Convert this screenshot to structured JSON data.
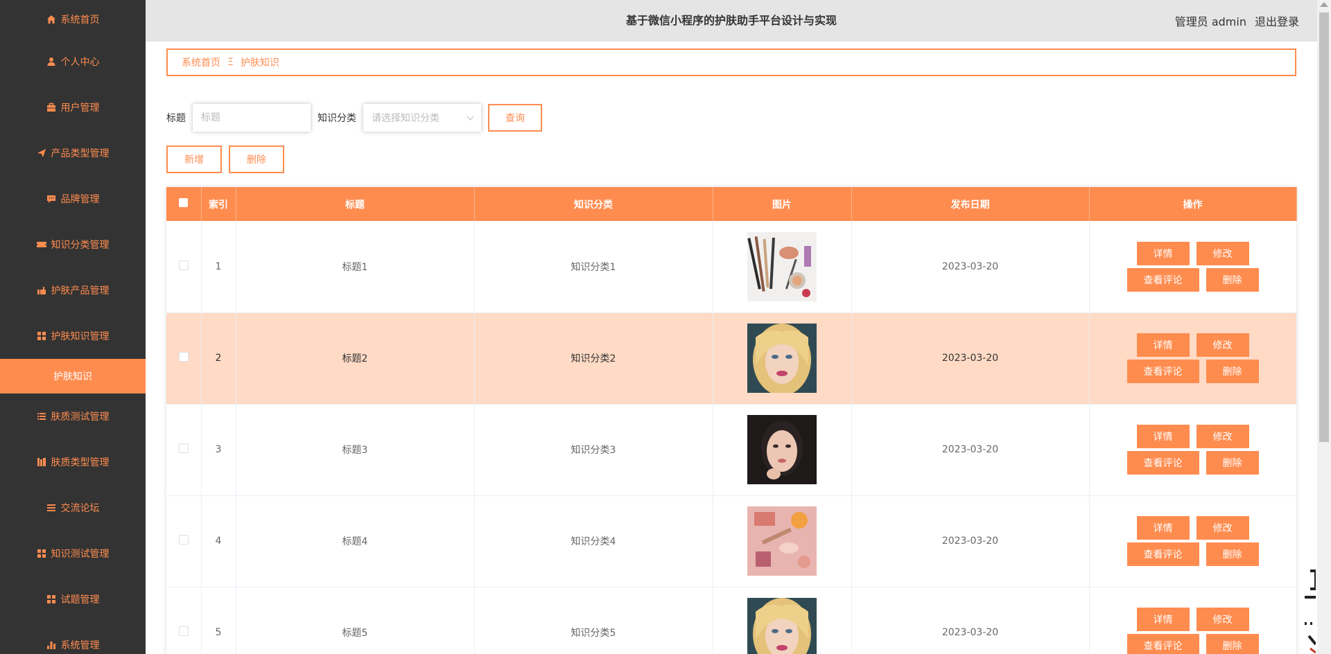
{
  "header": {
    "title": "基于微信小程序的护肤助手平台设计与实现",
    "user": "管理员 admin",
    "logout": "退出登录"
  },
  "sidebar": {
    "items": [
      {
        "label": "系统首页",
        "icon": "home-icon"
      },
      {
        "label": "个人中心",
        "icon": "user-icon"
      },
      {
        "label": "用户管理",
        "icon": "briefcase-icon"
      },
      {
        "label": "产品类型管理",
        "icon": "paper-plane-icon"
      },
      {
        "label": "品牌管理",
        "icon": "chat-icon"
      },
      {
        "label": "知识分类管理",
        "icon": "ticket-icon"
      },
      {
        "label": "护肤产品管理",
        "icon": "hand-icon"
      },
      {
        "label": "护肤知识管理",
        "icon": "grid-icon"
      },
      {
        "label": "肤质测试管理",
        "icon": "list-icon"
      },
      {
        "label": "肤质类型管理",
        "icon": "book-icon"
      },
      {
        "label": "交流论坛",
        "icon": "menu-icon"
      },
      {
        "label": "知识测试管理",
        "icon": "grid-icon"
      },
      {
        "label": "试题管理",
        "icon": "grid-icon"
      },
      {
        "label": "系统管理",
        "icon": "bar-chart-icon"
      }
    ],
    "active_sub": "护肤知识"
  },
  "breadcrumb": {
    "home": "系统首页",
    "separator": "Ξ",
    "current": "护肤知识"
  },
  "search": {
    "title_label": "标题",
    "title_placeholder": "标题",
    "category_label": "知识分类",
    "category_placeholder": "请选择知识分类",
    "query_button": "查询"
  },
  "actions": {
    "add": "新增",
    "delete": "删除"
  },
  "table": {
    "columns": [
      "索引",
      "标题",
      "知识分类",
      "图片",
      "发布日期",
      "操作"
    ],
    "buttons": {
      "detail": "详情",
      "edit": "修改",
      "comments": "查看评论",
      "delete": "删除"
    },
    "rows": [
      {
        "index": "1",
        "title": "标题1",
        "category": "知识分类1",
        "date": "2023-03-20",
        "image": "makeup-brushes"
      },
      {
        "index": "2",
        "title": "标题2",
        "category": "知识分类2",
        "date": "2023-03-20",
        "image": "blonde-portrait"
      },
      {
        "index": "3",
        "title": "标题3",
        "category": "知识分类3",
        "date": "2023-03-20",
        "image": "dark-hair-portrait"
      },
      {
        "index": "4",
        "title": "标题4",
        "category": "知识分类4",
        "date": "2023-03-20",
        "image": "pink-cosmetics-flatlay"
      },
      {
        "index": "5",
        "title": "标题5",
        "category": "知识分类5",
        "date": "2023-03-20",
        "image": "blonde-portrait"
      }
    ]
  },
  "colors": {
    "accent": "#ff8c4f",
    "sidebar_bg": "#333333",
    "header_bg": "#e6e5e5",
    "highlight_row": "#ffdac5"
  }
}
